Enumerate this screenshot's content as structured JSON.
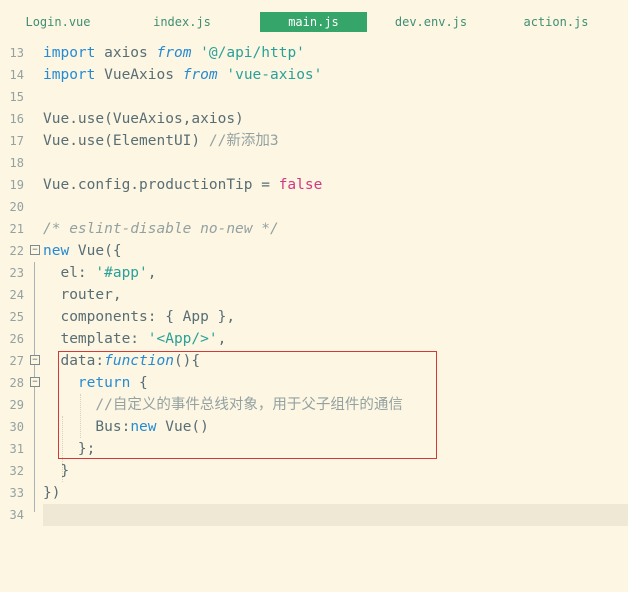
{
  "tabs": [
    {
      "label": "Login.vue",
      "active": false
    },
    {
      "label": "index.js",
      "active": false
    },
    {
      "label": "main.js",
      "active": true
    },
    {
      "label": "dev.env.js",
      "active": false
    },
    {
      "label": "action.js",
      "active": false
    }
  ],
  "colors": {
    "background": "#fdf6e3",
    "active_tab": "#35a56a",
    "keyword": "#268bd2",
    "string": "#2aa198",
    "comment": "#93a1a1",
    "boolean": "#d33682",
    "highlight_border": "#d23a3a"
  },
  "lines": [
    {
      "num": "13",
      "t": [
        "import",
        " axios ",
        "from",
        " ",
        "'@/api/http'"
      ]
    },
    {
      "num": "14",
      "t": [
        "import",
        " VueAxios ",
        "from",
        " ",
        "'vue-axios'"
      ]
    },
    {
      "num": "15",
      "t": []
    },
    {
      "num": "16",
      "t": [
        "Vue.use(VueAxios,axios)"
      ]
    },
    {
      "num": "17",
      "t": [
        "Vue.use(ElementUI) ",
        "//新添加3"
      ]
    },
    {
      "num": "18",
      "t": []
    },
    {
      "num": "19",
      "t": [
        "Vue.config.productionTip = ",
        "false"
      ]
    },
    {
      "num": "20",
      "t": []
    },
    {
      "num": "21",
      "t": [
        "/* eslint-disable no-new */"
      ]
    },
    {
      "num": "22",
      "t": [
        "new",
        " Vue({"
      ]
    },
    {
      "num": "23",
      "t": [
        "  el: ",
        "'#app'",
        ","
      ]
    },
    {
      "num": "24",
      "t": [
        "  router,"
      ]
    },
    {
      "num": "25",
      "t": [
        "  components: { App },"
      ]
    },
    {
      "num": "26",
      "t": [
        "  template: ",
        "'<App/>'",
        ","
      ]
    },
    {
      "num": "27",
      "t": [
        "  data:",
        "function",
        "(){"
      ]
    },
    {
      "num": "28",
      "t": [
        "    ",
        "return",
        " {"
      ]
    },
    {
      "num": "29",
      "t": [
        "      //自定义的事件总线对象，用于父子组件的通信"
      ]
    },
    {
      "num": "30",
      "t": [
        "      Bus:",
        "new",
        " Vue()"
      ]
    },
    {
      "num": "31",
      "t": [
        "    };"
      ]
    },
    {
      "num": "32",
      "t": [
        "  }"
      ]
    },
    {
      "num": "33",
      "t": [
        "})"
      ]
    },
    {
      "num": "34",
      "t": []
    }
  ]
}
